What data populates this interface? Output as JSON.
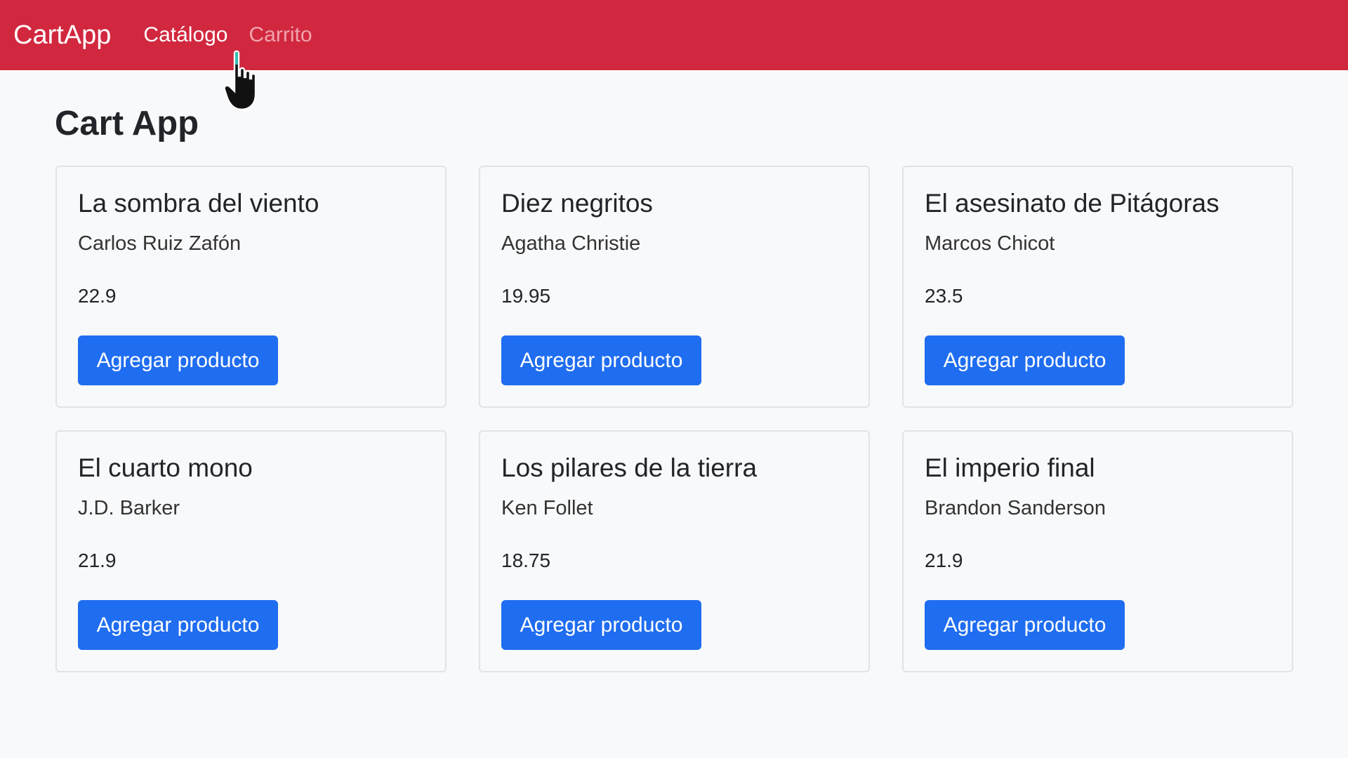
{
  "navbar": {
    "brand": "CartApp",
    "links": [
      "Catálogo",
      "Carrito"
    ]
  },
  "page": {
    "title": "Cart App"
  },
  "products": [
    {
      "title": "La sombra del viento",
      "author": "Carlos Ruiz Zafón",
      "price": "22.9",
      "button": "Agregar producto"
    },
    {
      "title": "Diez negritos",
      "author": "Agatha Christie",
      "price": "19.95",
      "button": "Agregar producto"
    },
    {
      "title": "El asesinato de Pitágoras",
      "author": "Marcos Chicot",
      "price": "23.5",
      "button": "Agregar producto"
    },
    {
      "title": "El cuarto mono",
      "author": "J.D. Barker",
      "price": "21.9",
      "button": "Agregar producto"
    },
    {
      "title": "Los pilares de la tierra",
      "author": "Ken Follet",
      "price": "18.75",
      "button": "Agregar producto"
    },
    {
      "title": "El imperio final",
      "author": "Brandon Sanderson",
      "price": "21.9",
      "button": "Agregar producto"
    }
  ],
  "colors": {
    "navbar": "#d1283f",
    "button": "#1f6df0",
    "background": "#f8f9fa"
  },
  "icons": {
    "cursor": "hand-pointer-icon"
  }
}
